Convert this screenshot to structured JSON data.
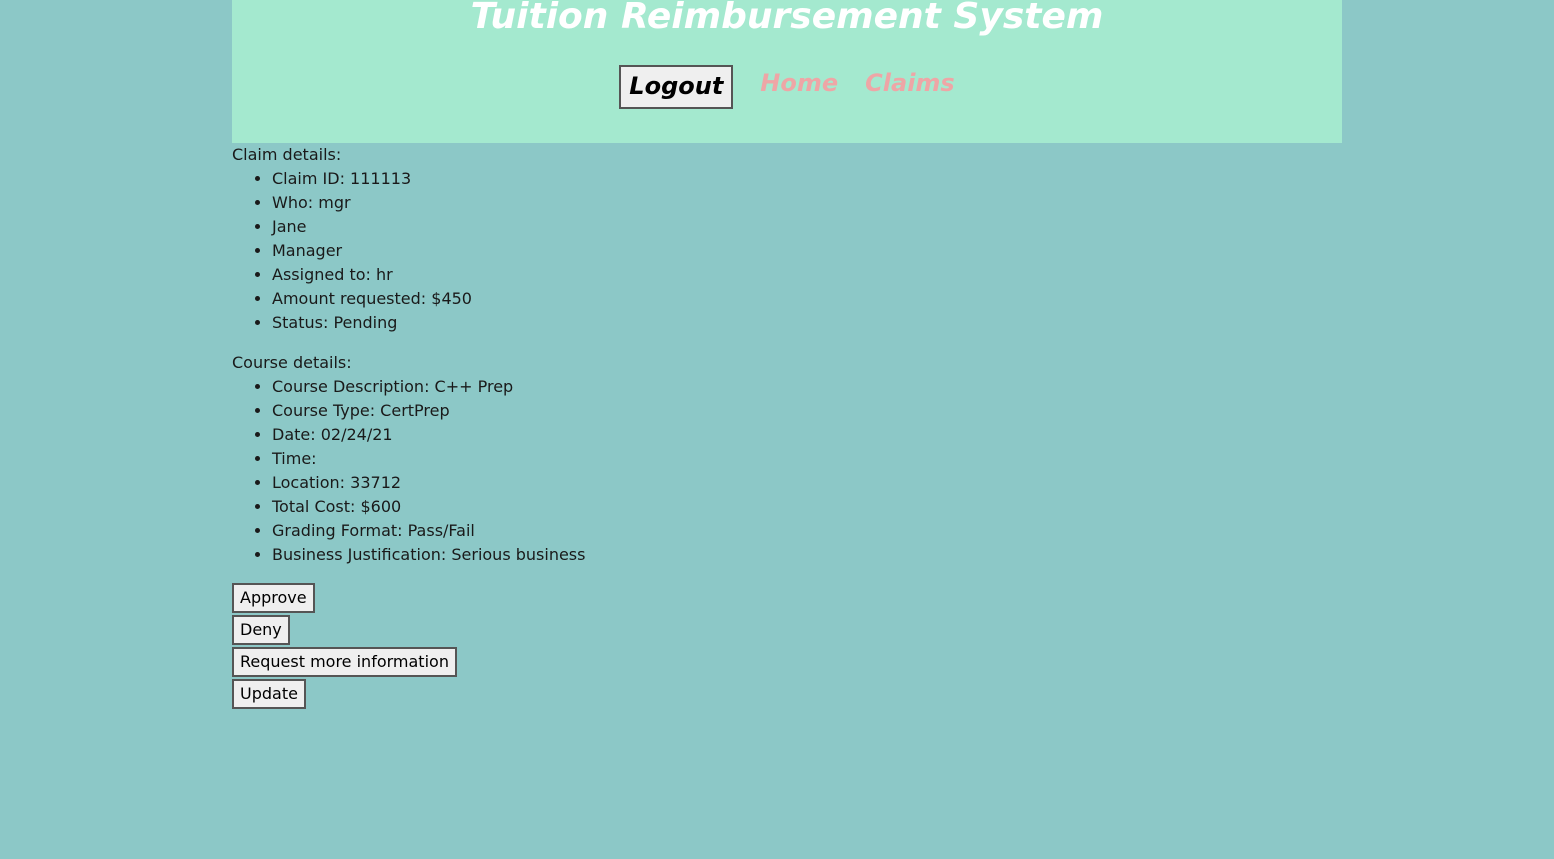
{
  "header": {
    "title": "Tuition Reimbursement System",
    "logout_label": "Logout",
    "nav_links": [
      "Home",
      "Claims"
    ]
  },
  "claim": {
    "heading": "Claim details:",
    "items": [
      "Claim ID: 111113",
      "Who: mgr",
      "Jane",
      "Manager",
      "Assigned to: hr",
      "Amount requested: $450",
      "Status: Pending"
    ]
  },
  "course": {
    "heading": "Course details:",
    "items": [
      "Course Description: C++ Prep",
      "Course Type: CertPrep",
      "Date: 02/24/21",
      "Time:",
      "Location: 33712",
      "Total Cost: $600",
      "Grading Format: Pass/Fail",
      "Business Justification: Serious business"
    ]
  },
  "actions": {
    "approve": "Approve",
    "deny": "Deny",
    "request_info": "Request more information",
    "update": "Update"
  },
  "colors": {
    "page_bg": "#8cc8c7",
    "header_bg": "#a4e9cf",
    "title": "#ffffff",
    "nav_link": "#eea6a6"
  }
}
